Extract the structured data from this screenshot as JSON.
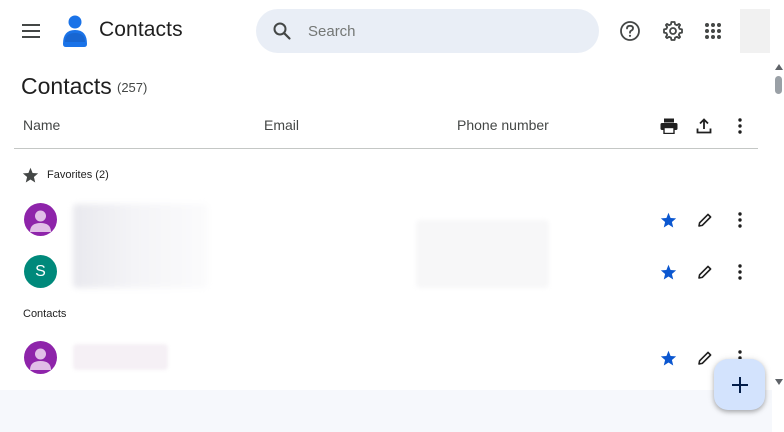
{
  "app": {
    "title": "Contacts"
  },
  "search": {
    "placeholder": "Search"
  },
  "page": {
    "title": "Contacts",
    "count": "(257)"
  },
  "columns": {
    "name": "Name",
    "email": "Email",
    "phone": "Phone number"
  },
  "sections": {
    "favorites": "Favorites (2)",
    "contacts": "Contacts"
  },
  "rows": [
    {
      "avatar_type": "person",
      "avatar_color": "#8e24aa",
      "avatar_letter": "",
      "starred": true
    },
    {
      "avatar_type": "letter",
      "avatar_color": "#00897b",
      "avatar_letter": "S",
      "starred": true
    },
    {
      "avatar_type": "person",
      "avatar_color": "#8e24aa",
      "avatar_letter": "",
      "starred": true
    }
  ],
  "icons": {
    "menu": "menu-icon",
    "logo": "contacts-logo",
    "search": "search-icon",
    "help": "help-icon",
    "settings": "gear-icon",
    "apps": "apps-grid-icon",
    "print": "print-icon",
    "export": "export-icon",
    "more": "more-vert-icon",
    "star": "star-icon",
    "edit": "pencil-icon",
    "add": "plus-icon"
  },
  "colors": {
    "accent": "#0b57d0",
    "search_bg": "#e9eef6",
    "fab_bg": "#d3e3fd",
    "logo_blue": "#1a73e8"
  }
}
